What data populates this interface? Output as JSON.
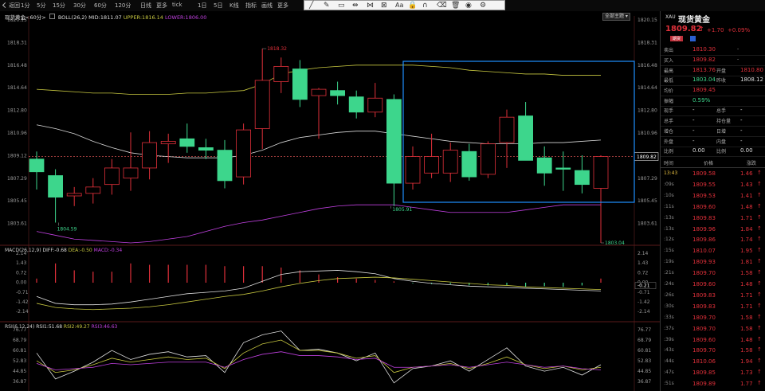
{
  "toolbar": {
    "items": [
      {
        "label": "返回",
        "icon": "back-icon"
      },
      {
        "label": "1分"
      },
      {
        "label": "5分"
      },
      {
        "label": "15分"
      },
      {
        "label": "30分"
      },
      {
        "label": "60分"
      },
      {
        "label": "120分"
      },
      {
        "label": "日线"
      },
      {
        "label": "更多"
      },
      {
        "label": "tick"
      },
      {
        "label": "1日"
      },
      {
        "label": "5日"
      },
      {
        "label": "K线"
      },
      {
        "label": "指标"
      },
      {
        "label": "画线"
      },
      {
        "label": "更多"
      }
    ]
  },
  "drawing_tools": [
    "line-tool-icon",
    "pen-tool-icon",
    "rect-tool-icon",
    "measure-tool-icon",
    "channel-tool-icon",
    "pattern-tool-icon",
    "text-tool-icon",
    "lock-icon",
    "magnet-icon",
    "eraser-icon",
    "trash-icon",
    "eye-icon",
    "settings-icon"
  ],
  "drawing_tools_text": "Aa",
  "info_bar": {
    "symbol_label": "现货黄金<60分>",
    "indicator": "BOLL(26,2)",
    "mid": "MID:1811.07",
    "upper": "UPPER:1816.14",
    "lower": "LOWER:1806.00",
    "theme_button": "全部主题"
  },
  "price_axis_left": [
    "1820.15",
    "1818.31",
    "1816.48",
    "1814.64",
    "1812.80",
    "1810.96",
    "1809.12",
    "1807.29",
    "1805.45",
    "1803.61"
  ],
  "price_axis_right": [
    "1820.15",
    "1818.31",
    "1816.48",
    "1814.64",
    "1812.80",
    "1810.96",
    "1809.12",
    "1807.29",
    "1805.45",
    "1803.61"
  ],
  "price_annotations": {
    "high": "1818.32",
    "low1": "1804.59",
    "low2": "1805.91",
    "low3": "1803.04",
    "current": "1809.82"
  },
  "macd": {
    "header": "MACD(26,12,9)",
    "diff": "DIFF:-0.68",
    "dea": "DEA:-0.50",
    "macd_val": "MACD:-0.34",
    "axis": [
      "2.14",
      "1.43",
      "0.72",
      "0.00",
      "-0.71",
      "-1.42",
      "-2.14"
    ],
    "current": "-0.21"
  },
  "rsi": {
    "header": "RSI(6,12,24)",
    "rsi1": "RSI1:51.68",
    "rsi2": "RSI2:49.27",
    "rsi3": "RSI3:46.63",
    "axis": [
      "76.77",
      "68.79",
      "60.81",
      "52.83",
      "44.85",
      "36.87"
    ]
  },
  "quote": {
    "symbol_code": "XAU",
    "name": "现货黄金",
    "price": "1809.82",
    "arrow": "↑",
    "change": "+1.70",
    "change_pct": "+0.09%",
    "badge": "期货",
    "sell_label": "卖出",
    "sell_val": "1810.30",
    "sell_extra": "-",
    "buy_label": "买入",
    "buy_val": "1809.82",
    "buy_extra": "-",
    "high_label": "最高",
    "high_val": "1813.76",
    "open_label": "开盘",
    "open_val": "1810.80",
    "low_label": "最低",
    "low_val": "1803.04",
    "prev_label": "昨收",
    "prev_val": "1808.12",
    "avg_label": "均价",
    "avg_val": "1809.45",
    "amp_label": "振幅",
    "amp_val": "0.59%",
    "now_label": "现手",
    "total_label": "总手",
    "vol_label": "总手",
    "hold_label": "持仓量",
    "chg_label": "增仓",
    "daily_label": "日增",
    "out_label": "外盘",
    "in_label": "内盘",
    "ratio_label": "比例",
    "ratio_val": "0.00",
    "ratio2_label": "比例",
    "ratio2_val": "0.00",
    "dash": "-"
  },
  "ticks_header": {
    "time": "时间",
    "price": "价格",
    "change": "涨跌"
  },
  "ticks": [
    {
      "time": "13:43",
      "price": "1809.58",
      "chg": "1.46",
      "dir": "up"
    },
    {
      "time": ":09s",
      "price": "1809.55",
      "chg": "1.43",
      "dir": "up"
    },
    {
      "time": ":10s",
      "price": "1809.53",
      "chg": "1.41",
      "dir": "up"
    },
    {
      "time": ":11s",
      "price": "1809.60",
      "chg": "1.48",
      "dir": "up"
    },
    {
      "time": ":13s",
      "price": "1809.83",
      "chg": "1.71",
      "dir": "up"
    },
    {
      "time": ":13s",
      "price": "1809.96",
      "chg": "1.84",
      "dir": "up"
    },
    {
      "time": ":12s",
      "price": "1809.86",
      "chg": "1.74",
      "dir": "up"
    },
    {
      "time": ":15s",
      "price": "1810.07",
      "chg": "1.95",
      "dir": "up"
    },
    {
      "time": ":19s",
      "price": "1809.93",
      "chg": "1.81",
      "dir": "up"
    },
    {
      "time": ":21s",
      "price": "1809.70",
      "chg": "1.58",
      "dir": "up"
    },
    {
      "time": ":24s",
      "price": "1809.60",
      "chg": "1.48",
      "dir": "up"
    },
    {
      "time": ":26s",
      "price": "1809.83",
      "chg": "1.71",
      "dir": "up"
    },
    {
      "time": ":30s",
      "price": "1809.83",
      "chg": "1.71",
      "dir": "up"
    },
    {
      "time": ":33s",
      "price": "1809.70",
      "chg": "1.58",
      "dir": "up"
    },
    {
      "time": ":37s",
      "price": "1809.70",
      "chg": "1.58",
      "dir": "up"
    },
    {
      "time": ":39s",
      "price": "1809.60",
      "chg": "1.48",
      "dir": "up"
    },
    {
      "time": ":43s",
      "price": "1809.70",
      "chg": "1.58",
      "dir": "up"
    },
    {
      "time": ":44s",
      "price": "1810.06",
      "chg": "1.94",
      "dir": "up"
    },
    {
      "time": ":47s",
      "price": "1809.85",
      "chg": "1.73",
      "dir": "up"
    },
    {
      "time": ":51s",
      "price": "1809.89",
      "chg": "1.77",
      "dir": "up"
    }
  ],
  "colors": {
    "up": "#e0303a",
    "down": "#3dd68c",
    "mid_line": "#d8d8d8",
    "upper_line": "#c8c840",
    "lower_line": "#c040e0",
    "selection": "#1e90ff",
    "dashed": "#d05050"
  },
  "chart_data": {
    "type": "candlestick",
    "ylim": [
      1803.0,
      1820.5
    ],
    "candles": [
      {
        "o": 1809.6,
        "h": 1810.2,
        "l": 1807.2,
        "c": 1808.6
      },
      {
        "o": 1808.3,
        "h": 1808.8,
        "l": 1804.6,
        "c": 1806.6
      },
      {
        "o": 1806.7,
        "h": 1807.4,
        "l": 1805.9,
        "c": 1806.9
      },
      {
        "o": 1806.9,
        "h": 1808.1,
        "l": 1806.1,
        "c": 1807.4
      },
      {
        "o": 1807.6,
        "h": 1809.6,
        "l": 1806.8,
        "c": 1808.9
      },
      {
        "o": 1808.1,
        "h": 1811.7,
        "l": 1807.1,
        "c": 1808.9
      },
      {
        "o": 1808.9,
        "h": 1811.8,
        "l": 1808.0,
        "c": 1810.9
      },
      {
        "o": 1810.8,
        "h": 1811.6,
        "l": 1809.3,
        "c": 1811.0
      },
      {
        "o": 1811.2,
        "h": 1812.4,
        "l": 1810.1,
        "c": 1810.6
      },
      {
        "o": 1810.5,
        "h": 1811.2,
        "l": 1809.6,
        "c": 1810.3
      },
      {
        "o": 1810.3,
        "h": 1811.1,
        "l": 1807.3,
        "c": 1807.9
      },
      {
        "o": 1808.2,
        "h": 1812.4,
        "l": 1807.6,
        "c": 1811.9
      },
      {
        "o": 1812.0,
        "h": 1818.3,
        "l": 1810.4,
        "c": 1815.8
      },
      {
        "o": 1815.7,
        "h": 1817.6,
        "l": 1814.8,
        "c": 1816.9
      },
      {
        "o": 1816.7,
        "h": 1817.4,
        "l": 1813.7,
        "c": 1814.3
      },
      {
        "o": 1814.6,
        "h": 1815.2,
        "l": 1811.2,
        "c": 1815.1
      },
      {
        "o": 1815.0,
        "h": 1815.7,
        "l": 1813.9,
        "c": 1814.6
      },
      {
        "o": 1814.5,
        "h": 1815.0,
        "l": 1812.8,
        "c": 1813.3
      },
      {
        "o": 1813.3,
        "h": 1815.6,
        "l": 1812.9,
        "c": 1814.4
      },
      {
        "o": 1814.3,
        "h": 1814.7,
        "l": 1805.9,
        "c": 1807.7
      },
      {
        "o": 1807.7,
        "h": 1810.6,
        "l": 1807.2,
        "c": 1809.8
      },
      {
        "o": 1808.5,
        "h": 1811.6,
        "l": 1808.1,
        "c": 1809.8
      },
      {
        "o": 1808.5,
        "h": 1810.9,
        "l": 1807.8,
        "c": 1810.3
      },
      {
        "o": 1810.2,
        "h": 1810.8,
        "l": 1807.9,
        "c": 1808.2
      },
      {
        "o": 1808.4,
        "h": 1811.0,
        "l": 1808.1,
        "c": 1810.8
      },
      {
        "o": 1810.9,
        "h": 1813.5,
        "l": 1808.9,
        "c": 1812.9
      },
      {
        "o": 1813.0,
        "h": 1814.1,
        "l": 1809.7,
        "c": 1809.5
      },
      {
        "o": 1809.7,
        "h": 1810.6,
        "l": 1807.5,
        "c": 1808.5
      },
      {
        "o": 1808.9,
        "h": 1810.2,
        "l": 1807.1,
        "c": 1808.8
      },
      {
        "o": 1808.7,
        "h": 1809.9,
        "l": 1806.9,
        "c": 1807.6
      },
      {
        "o": 1807.3,
        "h": 1809.9,
        "l": 1803.0,
        "c": 1809.8
      }
    ],
    "mid": [
      1812.3,
      1812.0,
      1811.6,
      1811.0,
      1810.5,
      1810.1,
      1809.9,
      1809.8,
      1809.7,
      1809.7,
      1809.7,
      1809.9,
      1810.3,
      1810.9,
      1811.3,
      1811.5,
      1811.7,
      1811.8,
      1811.8,
      1811.6,
      1811.4,
      1811.2,
      1811.0,
      1810.9,
      1810.8,
      1810.8,
      1810.8,
      1810.9,
      1810.9,
      1811.0,
      1811.1
    ],
    "upper": [
      1815.1,
      1815.0,
      1814.9,
      1814.8,
      1814.8,
      1814.7,
      1814.7,
      1814.7,
      1814.8,
      1814.8,
      1814.9,
      1815.0,
      1815.5,
      1816.3,
      1816.6,
      1816.8,
      1816.9,
      1817.0,
      1817.0,
      1817.0,
      1817.0,
      1816.9,
      1816.8,
      1816.6,
      1816.5,
      1816.4,
      1816.3,
      1816.3,
      1816.2,
      1816.2,
      1816.2
    ],
    "lower": [
      1803.9,
      1803.6,
      1803.3,
      1803.2,
      1803.1,
      1803.0,
      1803.1,
      1803.3,
      1803.5,
      1803.9,
      1804.3,
      1804.6,
      1804.8,
      1805.1,
      1805.4,
      1805.7,
      1805.9,
      1806.0,
      1806.0,
      1806.0,
      1805.8,
      1805.6,
      1805.4,
      1805.4,
      1805.4,
      1805.4,
      1805.6,
      1805.8,
      1806.0,
      1806.0,
      1806.0
    ],
    "macd_hist": [
      0.3,
      1.4,
      0.9,
      0.8,
      0.8,
      1.4,
      1.3,
      1.3,
      1.3,
      1.3,
      1.2,
      1.2,
      1.2,
      1.1,
      0.9,
      0.6,
      0.4,
      0.3,
      0.2,
      0.1,
      -0.05,
      -0.1,
      -0.1,
      -0.2,
      -0.2,
      -0.2,
      -0.3,
      -0.25,
      -0.3,
      -0.2,
      0.3
    ],
    "macd_diff": [
      -1.0,
      -1.5,
      -1.6,
      -1.6,
      -1.55,
      -1.4,
      -1.2,
      -1.0,
      -0.8,
      -0.7,
      -0.6,
      -0.4,
      0.1,
      0.6,
      0.8,
      0.85,
      0.9,
      0.8,
      0.65,
      0.3,
      0.1,
      -0.05,
      -0.15,
      -0.25,
      -0.3,
      -0.35,
      -0.4,
      -0.45,
      -0.5,
      -0.55,
      -0.6
    ],
    "macd_dea": [
      -1.5,
      -1.8,
      -1.9,
      -1.95,
      -1.9,
      -1.85,
      -1.75,
      -1.6,
      -1.4,
      -1.2,
      -1.0,
      -0.85,
      -0.6,
      -0.3,
      -0.05,
      0.15,
      0.3,
      0.35,
      0.4,
      0.35,
      0.25,
      0.15,
      0.05,
      -0.05,
      -0.15,
      -0.2,
      -0.3,
      -0.35,
      -0.4,
      -0.45,
      -0.5
    ],
    "rsi1": [
      60,
      40,
      46,
      53,
      62,
      55,
      59,
      61,
      57,
      58,
      45,
      68,
      74,
      77,
      62,
      63,
      60,
      54,
      60,
      37,
      48,
      50,
      54,
      46,
      55,
      64,
      50,
      46,
      49,
      43,
      51
    ],
    "rsi2": [
      54,
      45,
      47,
      51,
      56,
      53,
      55,
      57,
      55,
      56,
      48,
      60,
      67,
      70,
      62,
      62,
      60,
      56,
      58,
      45,
      49,
      50,
      52,
      48,
      52,
      57,
      51,
      48,
      50,
      47,
      49
    ],
    "rsi3": [
      52,
      47,
      48,
      49,
      52,
      51,
      52,
      53,
      53,
      53,
      49,
      55,
      59,
      61,
      58,
      58,
      57,
      55,
      56,
      49,
      49,
      50,
      51,
      49,
      51,
      53,
      51,
      49,
      50,
      48,
      47
    ]
  }
}
